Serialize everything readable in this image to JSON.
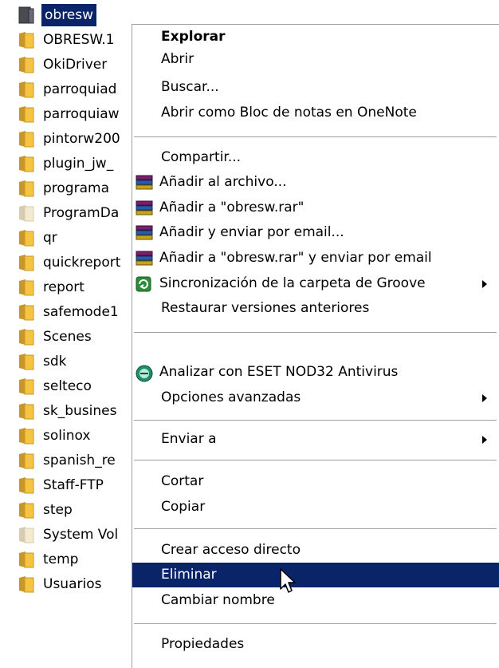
{
  "files": [
    {
      "name": "obresw",
      "selected": true
    },
    {
      "name": "OBRESW.1"
    },
    {
      "name": "OkiDriver"
    },
    {
      "name": "parroquiad"
    },
    {
      "name": "parroquiaw"
    },
    {
      "name": "pintorw200"
    },
    {
      "name": "plugin_jw_"
    },
    {
      "name": "programa"
    },
    {
      "name": "ProgramDa",
      "faded": true
    },
    {
      "name": "qr"
    },
    {
      "name": "quickreport"
    },
    {
      "name": "report"
    },
    {
      "name": "safemode1"
    },
    {
      "name": "Scenes"
    },
    {
      "name": "sdk"
    },
    {
      "name": "selteco"
    },
    {
      "name": "sk_busines"
    },
    {
      "name": "solinox"
    },
    {
      "name": "spanish_re"
    },
    {
      "name": "Staff-FTP"
    },
    {
      "name": "step"
    },
    {
      "name": "System Vol",
      "faded": true
    },
    {
      "name": "temp"
    },
    {
      "name": "Usuarios"
    }
  ],
  "menu": {
    "explorar": "Explorar",
    "abrir": "Abrir",
    "buscar": "Buscar...",
    "onenote": "Abrir como Bloc de notas en OneNote",
    "compartir": "Compartir...",
    "add_archive": "Añadir al archivo...",
    "add_rar": "Añadir a \"obresw.rar\"",
    "add_email": "Añadir y enviar por email...",
    "add_rar_email": "Añadir a \"obresw.rar\" y enviar por email",
    "groove": "Sincronización de la carpeta de Groove",
    "restore": "Restaurar versiones anteriores",
    "eset": "Analizar con ESET NOD32 Antivirus",
    "advanced": "Opciones avanzadas",
    "send_to": "Enviar a",
    "cut": "Cortar",
    "copy": "Copiar",
    "shortcut": "Crear acceso directo",
    "delete": "Eliminar",
    "rename": "Cambiar nombre",
    "properties": "Propiedades"
  },
  "colors": {
    "highlight": "#0a246a",
    "folder": "#f5c542"
  },
  "icons": {
    "folder": "folder-icon",
    "winrar": "winrar-icon",
    "groove": "groove-icon",
    "eset": "eset-icon",
    "submenu": "chevron-right-icon",
    "cursor": "mouse-pointer-icon"
  }
}
